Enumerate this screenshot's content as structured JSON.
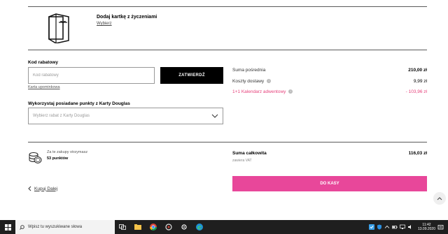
{
  "card": {
    "title": "Dodaj kartkę z życzeniami",
    "link": "Wybierz"
  },
  "promo": {
    "label": "Kod rabatowy",
    "placeholder": "Kod rabatowy",
    "confirm": "ZATWIERDŹ",
    "gift_card_link": "Karta upominkowa"
  },
  "points": {
    "label": "Wykorzystaj posiadane punkty z Karty Douglas",
    "select_placeholder": "Wybierz rabat z Karty Douglas"
  },
  "summary": {
    "subtotal_label": "Suma pośrednia",
    "subtotal_value": "210,00 zł",
    "shipping_label": "Koszty dostawy",
    "shipping_value": "9,99 zł",
    "discount_label": "1+1 Kalendarz adwentowy",
    "discount_value": "- 103,96 zł",
    "total_label": "Suma całkowita",
    "total_value": "116,03 zł",
    "vat_label": "zawiera VAT"
  },
  "rewards": {
    "line1": "Za te zakupy otrzymasz",
    "line2": "53 punktów"
  },
  "nav": {
    "back": "Kupuj Dalej",
    "checkout": "DO KASY"
  },
  "taskbar": {
    "search_placeholder": "Wpisz tu wyszukiwane słowa",
    "time": "11:42",
    "date": "13.09.2020"
  },
  "colors": {
    "accent": "#e8479a",
    "discount": "#e6417b"
  }
}
